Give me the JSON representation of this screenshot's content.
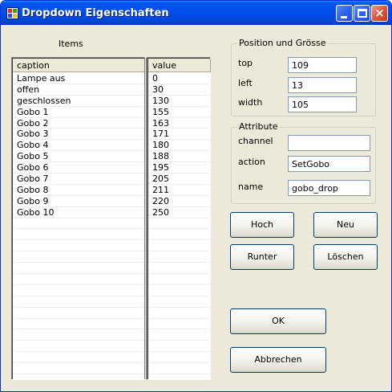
{
  "window": {
    "title": "Dropdown Eigenschaften"
  },
  "titlebar": {
    "minimize": "minimize",
    "maximize": "maximize",
    "close": "×"
  },
  "items": {
    "label": "Items",
    "columns": {
      "caption": "caption",
      "value": "value"
    },
    "rows": [
      {
        "caption": "Lampe aus",
        "value": "0"
      },
      {
        "caption": "offen",
        "value": "30"
      },
      {
        "caption": "geschlossen",
        "value": "130"
      },
      {
        "caption": "Gobo 1",
        "value": "155"
      },
      {
        "caption": "Gobo 2",
        "value": "163"
      },
      {
        "caption": "Gobo 3",
        "value": "171"
      },
      {
        "caption": "Gobo 4",
        "value": "180"
      },
      {
        "caption": "Gobo 5",
        "value": "188"
      },
      {
        "caption": "Gobo 6",
        "value": "195"
      },
      {
        "caption": "Gobo 7",
        "value": "205"
      },
      {
        "caption": "Gobo 8",
        "value": "211"
      },
      {
        "caption": "Gobo 9",
        "value": "220"
      },
      {
        "caption": "Gobo 10",
        "value": "250"
      }
    ]
  },
  "position": {
    "title": "Position und Grösse",
    "top_label": "top",
    "top_value": "109",
    "left_label": "left",
    "left_value": "13",
    "width_label": "width",
    "width_value": "105"
  },
  "attribute": {
    "title": "Attribute",
    "channel_label": "channel",
    "channel_value": "",
    "action_label": "action",
    "action_value": "SetGobo",
    "name_label": "name",
    "name_value": "gobo_drop"
  },
  "buttons": {
    "hoch": "Hoch",
    "neu": "Neu",
    "runter": "Runter",
    "loeschen": "Löschen",
    "ok": "OK",
    "abbrechen": "Abbrechen"
  }
}
